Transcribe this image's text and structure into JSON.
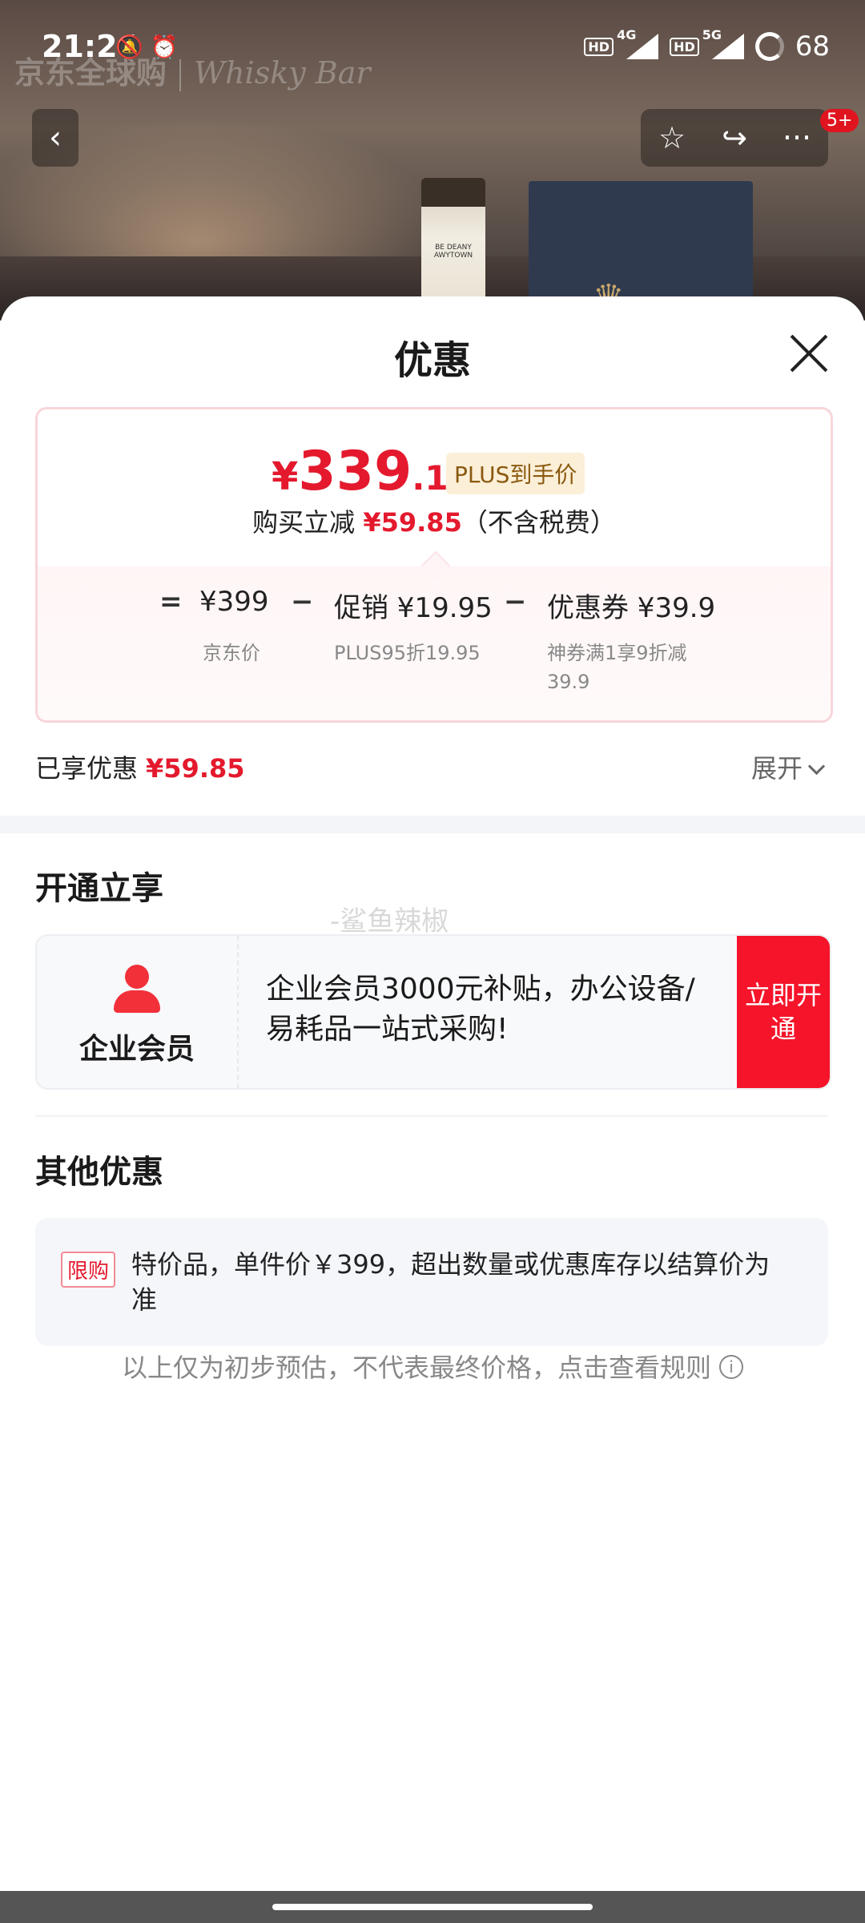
{
  "status_bar": {
    "time": "21:24",
    "left_icons": "🔕 ⏰",
    "net1": "4G",
    "net2": "5G",
    "hd": "HD",
    "battery": "68"
  },
  "background": {
    "brand_cn": "京东全球购",
    "brand_en": "Whisky Bar",
    "bottle_label": "BE DEANY AWYTOWN",
    "badge": "5+"
  },
  "sheet": {
    "title": "优惠",
    "price": {
      "yen": "¥",
      "int": "339",
      "dec": ".15",
      "tag": "PLUS到手价",
      "reduce_prefix": "购买立减",
      "reduce_value": "¥59.85",
      "reduce_suffix": "（不含税费）"
    },
    "formula": {
      "eq": "=",
      "minus": "−",
      "base_value": "¥399",
      "base_label": "京东价",
      "promo_value": "促销 ¥19.95",
      "promo_label": "PLUS95折19.95",
      "coupon_value": "优惠券 ¥39.9",
      "coupon_label_line1": "神券满1享9折减",
      "coupon_label_line2": "39.9"
    },
    "enjoyed_label": "已享优惠",
    "enjoyed_value": "¥59.85",
    "expand_label": "展开",
    "section_open": "开通立享",
    "member": {
      "name": "企业会员",
      "desc": "企业会员3000元补贴，办公设备/易耗品一站式采购!",
      "button": "立即开通"
    },
    "watermark": "-鲨鱼辣椒",
    "section_other": "其他优惠",
    "other": {
      "tag": "限购",
      "text": "特价品，单件价￥399，超出数量或优惠库存以结算价为准"
    },
    "disclaimer": "以上仅为初步预估，不代表最终价格，点击查看规则"
  }
}
